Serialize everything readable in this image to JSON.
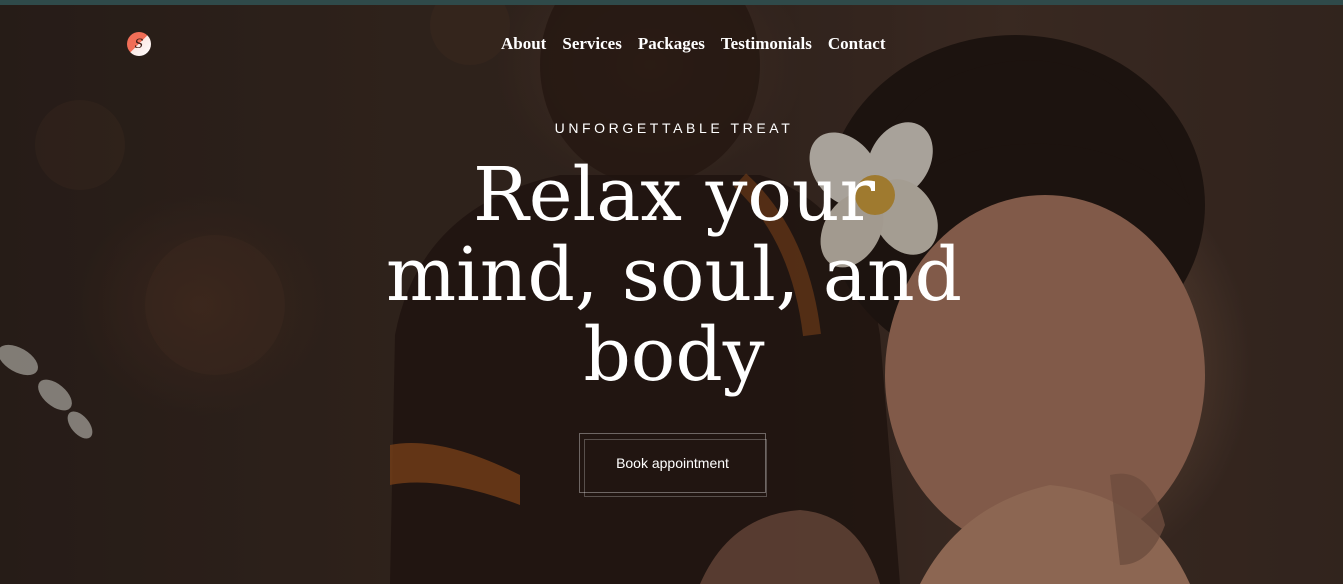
{
  "brand": {
    "logo_letter": "S",
    "logo_colors": [
      "#f06e57",
      "#ffffff"
    ]
  },
  "nav": {
    "items": [
      {
        "label": "About"
      },
      {
        "label": "Services"
      },
      {
        "label": "Packages"
      },
      {
        "label": "Testimonials"
      },
      {
        "label": "Contact"
      }
    ]
  },
  "hero": {
    "eyebrow": "UNFORGETTABLE TREAT",
    "headline_line1": "Relax your",
    "headline_line2": "mind, soul, and",
    "headline_line3": "body",
    "cta_label": "Book appointment",
    "background_photo": "spa-massage-photo"
  },
  "colors": {
    "top_bar": "#2f4a4a",
    "hero_bg": "#3a2b24",
    "text": "#ffffff"
  }
}
